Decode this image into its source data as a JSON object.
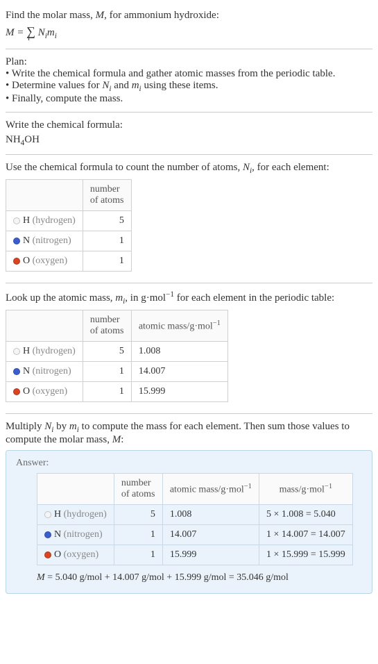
{
  "intro": {
    "line1_prefix": "Find the molar mass, ",
    "line1_var": "M",
    "line1_suffix": ", for ammonium hydroxide:",
    "formula_lhs": "M",
    "formula_eq": " = ",
    "formula_sum": "∑",
    "formula_sub": "i",
    "formula_rhs1": " N",
    "formula_rhs1_sub": "i",
    "formula_rhs2": "m",
    "formula_rhs2_sub": "i"
  },
  "plan": {
    "heading": "Plan:",
    "b1": "• Write the chemical formula and gather atomic masses from the periodic table.",
    "b2_a": "• Determine values for ",
    "b2_n": "N",
    "b2_ni": "i",
    "b2_b": " and ",
    "b2_m": "m",
    "b2_mi": "i",
    "b2_c": " using these items.",
    "b3": "• Finally, compute the mass."
  },
  "chem": {
    "heading": "Write the chemical formula:",
    "formula_nh": "NH",
    "formula_4": "4",
    "formula_oh": "OH"
  },
  "count": {
    "heading_a": "Use the chemical formula to count the number of atoms, ",
    "heading_n": "N",
    "heading_ni": "i",
    "heading_b": ", for each element:",
    "col1": "number of atoms"
  },
  "elements": [
    {
      "symbol": "H",
      "name": "(hydrogen)",
      "color": "#f5f5f5",
      "atoms": "5",
      "mass": "1.008",
      "calc": "5 × 1.008 = 5.040"
    },
    {
      "symbol": "N",
      "name": "(nitrogen)",
      "color": "#3a5fcd",
      "atoms": "1",
      "mass": "14.007",
      "calc": "1 × 14.007 = 14.007"
    },
    {
      "symbol": "O",
      "name": "(oxygen)",
      "color": "#d94423",
      "atoms": "1",
      "mass": "15.999",
      "calc": "1 × 15.999 = 15.999"
    }
  ],
  "lookup": {
    "heading_a": "Look up the atomic mass, ",
    "heading_m": "m",
    "heading_mi": "i",
    "heading_b": ", in g·mol",
    "heading_exp": "−1",
    "heading_c": " for each element in the periodic table:",
    "col1": "number of atoms",
    "col2_a": "atomic mass/g·mol",
    "col2_exp": "−1"
  },
  "multiply": {
    "line_a": "Multiply ",
    "line_n": "N",
    "line_ni": "i",
    "line_b": " by ",
    "line_m": "m",
    "line_mi": "i",
    "line_c": " to compute the mass for each element. Then sum those values to compute the molar mass, ",
    "line_mm": "M",
    "line_d": ":"
  },
  "answer": {
    "label": "Answer:",
    "col1": "number of atoms",
    "col2_a": "atomic mass/g·mol",
    "col2_exp": "−1",
    "col3_a": "mass/g·mol",
    "col3_exp": "−1",
    "final_a": "M",
    "final_b": " = 5.040 g/mol + 14.007 g/mol + 15.999 g/mol = 35.046 g/mol"
  }
}
